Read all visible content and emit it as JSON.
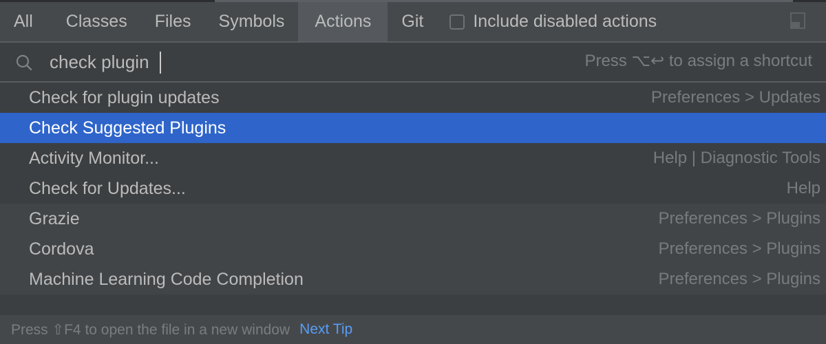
{
  "tabs": [
    {
      "label": "All",
      "active": false
    },
    {
      "label": "Classes",
      "active": false
    },
    {
      "label": "Files",
      "active": false
    },
    {
      "label": "Symbols",
      "active": false
    },
    {
      "label": "Actions",
      "active": true
    },
    {
      "label": "Git",
      "active": false
    }
  ],
  "options": {
    "include_disabled_label": "Include disabled actions",
    "include_disabled_checked": false,
    "pin_icon": "pin-window-icon"
  },
  "search": {
    "icon": "search-icon",
    "value": "check plugin",
    "hint": "Press ⌥↩ to assign a shortcut"
  },
  "results": [
    {
      "name": "Check for plugin updates",
      "location": "Preferences > Updates",
      "selected": false,
      "group": "a"
    },
    {
      "name": "Check Suggested Plugins",
      "location": "",
      "selected": true,
      "group": "a"
    },
    {
      "name": "Activity Monitor...",
      "location": "Help | Diagnostic Tools",
      "selected": false,
      "group": "a"
    },
    {
      "name": "Check for Updates...",
      "location": "Help",
      "selected": false,
      "group": "a"
    },
    {
      "name": "Grazie",
      "location": "Preferences > Plugins",
      "selected": false,
      "group": "b"
    },
    {
      "name": "Cordova",
      "location": "Preferences > Plugins",
      "selected": false,
      "group": "b"
    },
    {
      "name": "Machine Learning Code Completion",
      "location": "Preferences > Plugins",
      "selected": false,
      "group": "b"
    }
  ],
  "footer": {
    "tip": "Press ⇧F4 to open the file in a new window",
    "next_tip_label": "Next Tip"
  },
  "colors": {
    "selection": "#2f65ca",
    "link": "#589df6",
    "background": "#3c3f41"
  }
}
